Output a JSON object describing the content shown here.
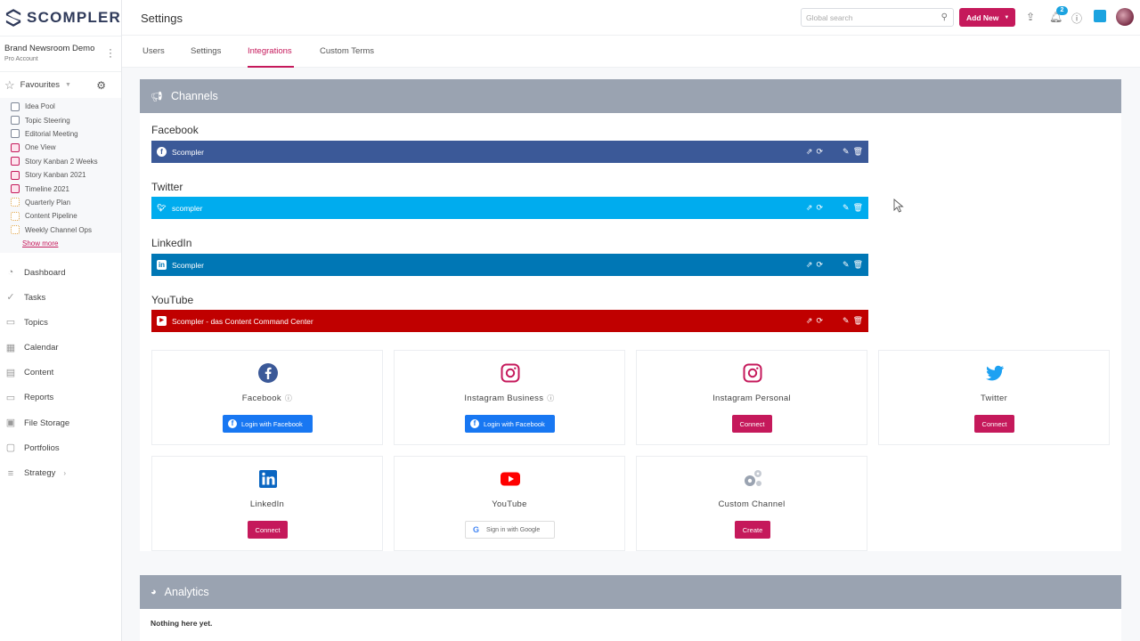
{
  "brand": {
    "name": "SCOMPLER"
  },
  "account": {
    "name": "Brand Newsroom Demo",
    "type": "Pro Account"
  },
  "favourites": {
    "title": "Favourites",
    "items": [
      {
        "label": "Idea Pool",
        "style": "grey"
      },
      {
        "label": "Topic Steering",
        "style": "grey"
      },
      {
        "label": "Editorial Meeting",
        "style": "grey"
      },
      {
        "label": "One View",
        "style": "pink"
      },
      {
        "label": "Story Kanban 2 Weeks",
        "style": "pink"
      },
      {
        "label": "Story Kanban 2021",
        "style": "pink"
      },
      {
        "label": "Timeline 2021",
        "style": "pink"
      },
      {
        "label": "Quarterly Plan",
        "style": "yellow"
      },
      {
        "label": "Content Pipeline",
        "style": "yellow"
      },
      {
        "label": "Weekly Channel Ops",
        "style": "yellow"
      }
    ],
    "show_more": "Show more"
  },
  "nav": [
    {
      "label": "Dashboard",
      "icon": "dashboard-icon"
    },
    {
      "label": "Tasks",
      "icon": "tasks-icon"
    },
    {
      "label": "Topics",
      "icon": "topics-icon"
    },
    {
      "label": "Calendar",
      "icon": "calendar-icon"
    },
    {
      "label": "Content",
      "icon": "content-icon"
    },
    {
      "label": "Reports",
      "icon": "reports-icon"
    },
    {
      "label": "File Storage",
      "icon": "file-storage-icon"
    },
    {
      "label": "Portfolios",
      "icon": "portfolios-icon"
    },
    {
      "label": "Strategy",
      "icon": "strategy-icon"
    }
  ],
  "header": {
    "title": "Settings",
    "search_placeholder": "Global search",
    "add_new": "Add New",
    "notification_count": "2"
  },
  "tabs": [
    {
      "label": "Users"
    },
    {
      "label": "Settings"
    },
    {
      "label": "Integrations",
      "active": true
    },
    {
      "label": "Custom Terms"
    }
  ],
  "channels": {
    "title": "Channels",
    "groups": [
      {
        "label": "Facebook",
        "account": "Scompler",
        "color": "#3b5998"
      },
      {
        "label": "Twitter",
        "account": "scompler",
        "color": "#00acee"
      },
      {
        "label": "LinkedIn",
        "account": "Scompler",
        "color": "#0077b5"
      },
      {
        "label": "YouTube",
        "account": "Scompler - das Content Command Center",
        "color": "#c00000"
      }
    ]
  },
  "connectors": [
    {
      "name": "Facebook",
      "button": "Login with Facebook",
      "info": true
    },
    {
      "name": "Instagram Business",
      "button": "Login with Facebook",
      "info": true
    },
    {
      "name": "Instagram Personal",
      "button": "Connect"
    },
    {
      "name": "Twitter",
      "button": "Connect"
    },
    {
      "name": "LinkedIn",
      "button": "Connect"
    },
    {
      "name": "YouTube",
      "button": "Sign in with Google"
    },
    {
      "name": "Custom Channel",
      "button": "Create"
    }
  ],
  "analytics": {
    "title": "Analytics",
    "empty": "Nothing here yet."
  },
  "colors": {
    "accent": "#c5195b",
    "panel_header": "#9aa3b1",
    "facebook_button": "#1877f2"
  }
}
